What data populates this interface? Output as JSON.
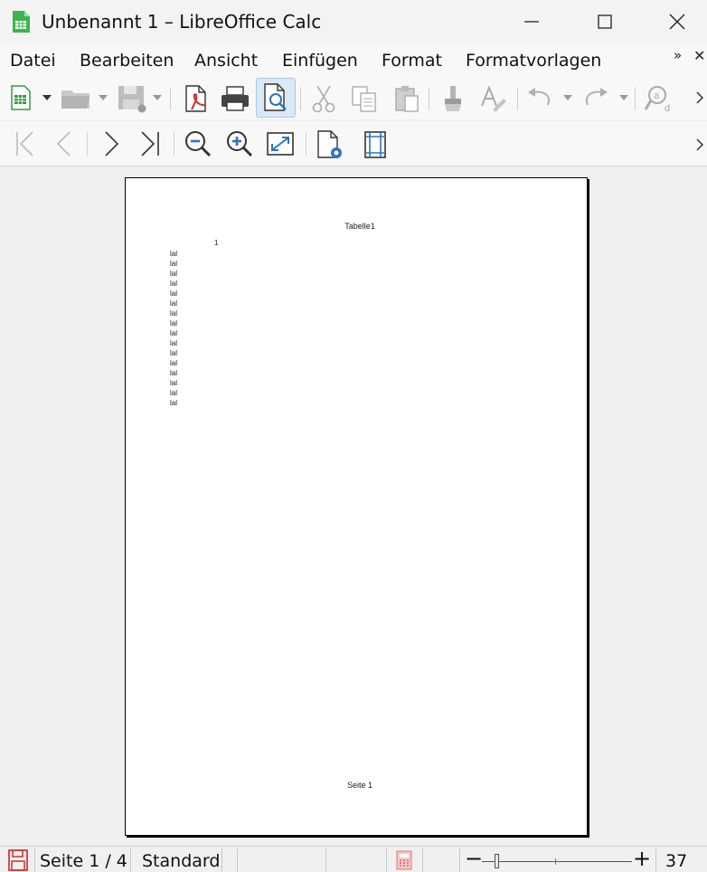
{
  "window": {
    "title": "Unbenannt 1 – LibreOffice Calc"
  },
  "menu": {
    "items": [
      "Datei",
      "Bearbeiten",
      "Ansicht",
      "Einfügen",
      "Format",
      "Formatvorlagen"
    ],
    "more": "»",
    "close": "✕"
  },
  "toolbar": {
    "standard": [
      "new-spreadsheet",
      "open",
      "save",
      "export-pdf",
      "print",
      "print-preview",
      "cut",
      "copy",
      "paste",
      "clone-formatting",
      "clear-formatting",
      "undo",
      "redo",
      "find-replace"
    ],
    "preview": [
      "first-page",
      "previous-page",
      "next-page",
      "last-page",
      "zoom-out",
      "zoom-in",
      "full-screen",
      "page-format",
      "margins"
    ]
  },
  "page": {
    "header": "Tabelle1",
    "column_header": "1",
    "rows": [
      "lal",
      "lal",
      "lal",
      "lal",
      "lal",
      "lal",
      "lal",
      "lal",
      "lal",
      "lal",
      "lal",
      "lal",
      "lal",
      "lal",
      "lal",
      "lal"
    ],
    "footer": "Seite 1"
  },
  "status": {
    "page": "Seite 1 / 4",
    "style": "Standard",
    "zoom": "37 %",
    "zoom_minus": "−",
    "zoom_plus": "+"
  },
  "colors": {
    "accent": "#2b73c9",
    "calc_green": "#2e9e3b",
    "pdf_red": "#d62b2b"
  }
}
